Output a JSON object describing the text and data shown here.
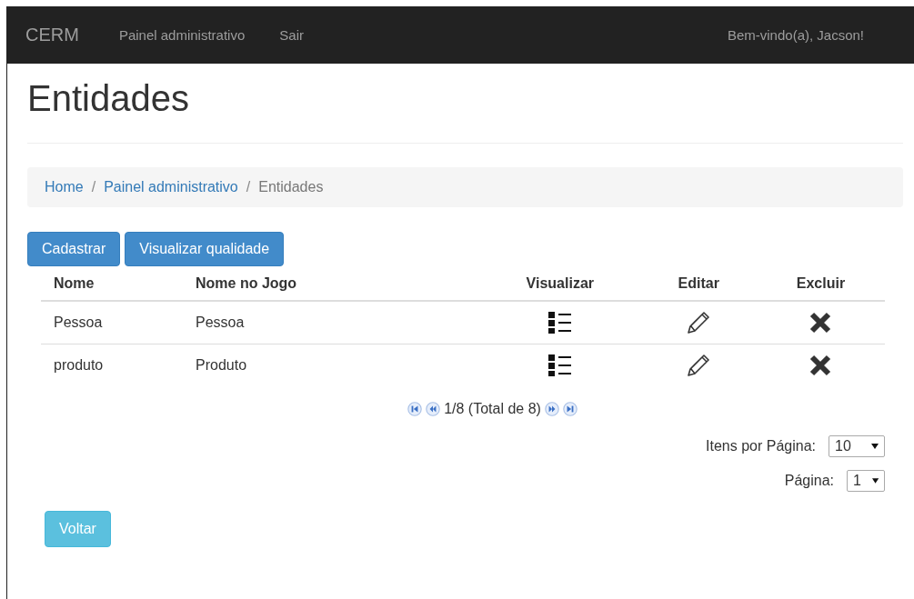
{
  "navbar": {
    "brand": "CERM",
    "links": [
      "Painel administrativo",
      "Sair"
    ],
    "welcome": "Bem-vindo(a), Jacson!"
  },
  "page_title": "Entidades",
  "breadcrumb": [
    {
      "label": "Home",
      "kind": "link"
    },
    {
      "separator_before": "/",
      "label": "Painel administrativo",
      "kind": "link"
    },
    {
      "separator_before": "/",
      "label": "Entidades",
      "kind": "current"
    }
  ],
  "actions": [
    "Cadastrar",
    "Visualizar qualidade"
  ],
  "table": {
    "columns": [
      "Nome",
      "Nome no Jogo",
      "Visualizar",
      "Editar",
      "Excluir"
    ],
    "rows": [
      {
        "nome": "Pessoa",
        "nome_no_jogo": "Pessoa"
      },
      {
        "nome": "produto",
        "nome_no_jogo": "Produto"
      }
    ]
  },
  "pagination": {
    "status": "1/8 (Total de 8)"
  },
  "items_per_page": {
    "label": "Itens por Página:",
    "value": "10"
  },
  "page_select": {
    "label": "Página:",
    "value": "1"
  },
  "back_button": "Voltar"
}
